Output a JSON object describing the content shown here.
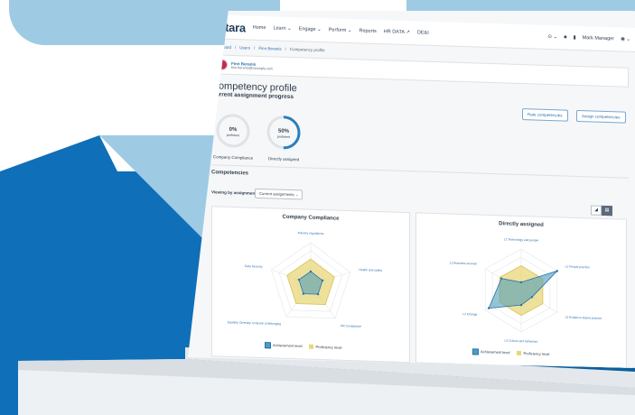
{
  "nav": {
    "logo": "totara",
    "items": [
      "Home",
      "Learn ⌄",
      "Engage ⌄",
      "Perform ⌄",
      "Reports",
      "HR DATA ↗",
      "DE&I"
    ],
    "user": "Mark Manager"
  },
  "breadcrumbs": [
    "Dashboard",
    "Users",
    "Finn Beranis",
    "Competency profile"
  ],
  "user_card": {
    "name": "Finn Beranis",
    "email": "finn.beranis@example.com"
  },
  "page": {
    "title": "Competency profile",
    "subtitle": "Current assignment progress"
  },
  "buttons": {
    "rate": "Rate competencies",
    "assign": "Assign competencies"
  },
  "progress": [
    {
      "percent_label": "0%",
      "caption": "proficient",
      "name": "Company Compliance",
      "value": 0
    },
    {
      "percent_label": "50%",
      "caption": "proficient",
      "name": "Directly assigned",
      "value": 0.5
    }
  ],
  "competencies": {
    "section_title": "Competencies",
    "filter_label": "Viewing by assignment",
    "filter_value": "Current assignments"
  },
  "charts": [
    {
      "title": "Company Compliance",
      "axes": [
        "Industry regulations",
        "Health and safety",
        "HR Compliance",
        "Equality, Diversity, Inclusion & Belonging",
        "Data Security"
      ],
      "proficiency": [
        0.6,
        0.6,
        0.6,
        0.6,
        0.6
      ],
      "achievement": [
        0.3,
        0.3,
        0.3,
        0.3,
        0.3
      ],
      "legend": {
        "achievement": "Achievement level",
        "proficiency": "Proficiency level"
      }
    },
    {
      "title": "Directly assigned",
      "axes": [
        "L2 Technology and people",
        "L1 People practice",
        "L3 Evidence-based practice",
        "L3 Culture and behaviour",
        "L2 Change",
        "L2 Business acumen"
      ],
      "proficiency": [
        0.6,
        0.6,
        0.6,
        0.6,
        0.6,
        0.6
      ],
      "achievement": [
        0.2,
        1.0,
        0.3,
        0.35,
        0.9,
        0.55
      ],
      "legend": {
        "achievement": "Achievement level",
        "proficiency": "Proficiency level"
      }
    }
  ],
  "colors": {
    "accent": "#2a6fb0",
    "proficiency": "#e8d77a",
    "achievement": "#4f9fb8",
    "background_blue": "#0f6fb8"
  }
}
